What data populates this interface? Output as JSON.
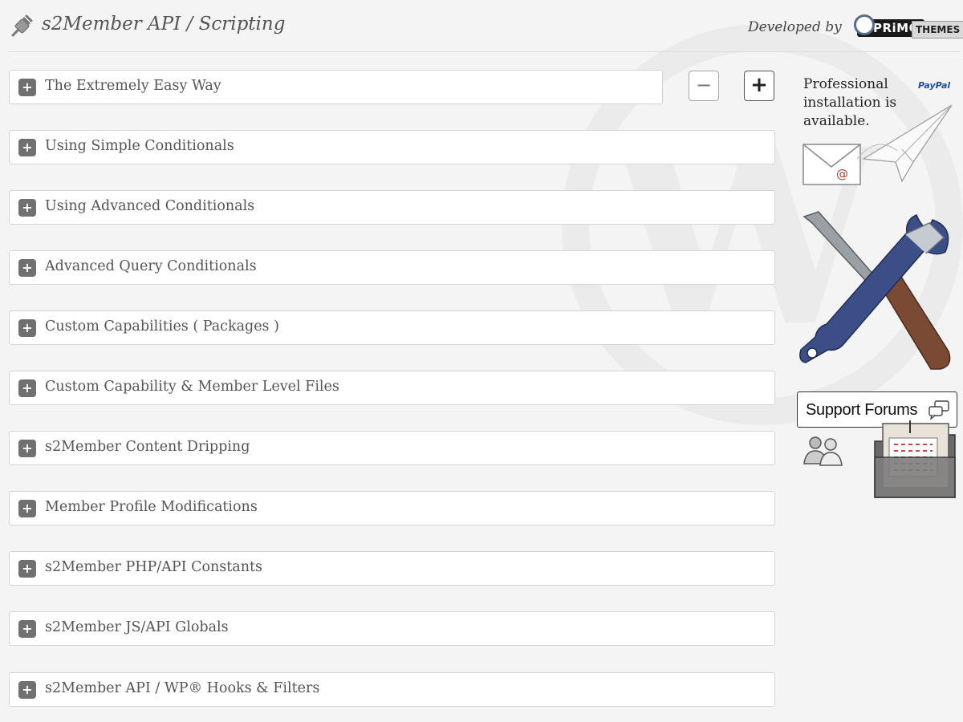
{
  "header": {
    "title": "s2Member API / Scripting",
    "developed_by": "Developed by",
    "logo_primo": "PRiMO",
    "logo_themes": "THEMES"
  },
  "controls": {
    "collapse_all": "−",
    "expand_all": "+"
  },
  "sections": [
    {
      "label": "The Extremely Easy Way",
      "toggle": "+"
    },
    {
      "label": "Using Simple Conditionals",
      "toggle": "+"
    },
    {
      "label": "Using Advanced Conditionals",
      "toggle": "+"
    },
    {
      "label": "Advanced Query Conditionals",
      "toggle": "+"
    },
    {
      "label": "Custom Capabilities ( Packages )",
      "toggle": "+"
    },
    {
      "label": "Custom Capability & Member Level Files",
      "toggle": "+"
    },
    {
      "label": "s2Member Content Dripping",
      "toggle": "+"
    },
    {
      "label": "Member Profile Modifications",
      "toggle": "+"
    },
    {
      "label": "s2Member PHP/API Constants",
      "toggle": "+"
    },
    {
      "label": "s2Member JS/API Globals",
      "toggle": "+"
    },
    {
      "label": "s2Member API / WP® Hooks & Filters",
      "toggle": "+"
    }
  ],
  "sidebar": {
    "install_line1": "Professional",
    "install_line2": "installation is",
    "install_line3": "available.",
    "paypal": "PayPal",
    "mail_symbol": "@",
    "support_forums": "Support Forums"
  },
  "icons": [
    "plugin-icon",
    "paper-plane-icon",
    "envelope-icon",
    "tools-icon",
    "chat-bubbles-icon",
    "people-icon",
    "folder-icon"
  ],
  "colors": {
    "background": "#f4f4f4",
    "toggle_bg": "#707070",
    "panel_border": "#d4d4d4"
  }
}
